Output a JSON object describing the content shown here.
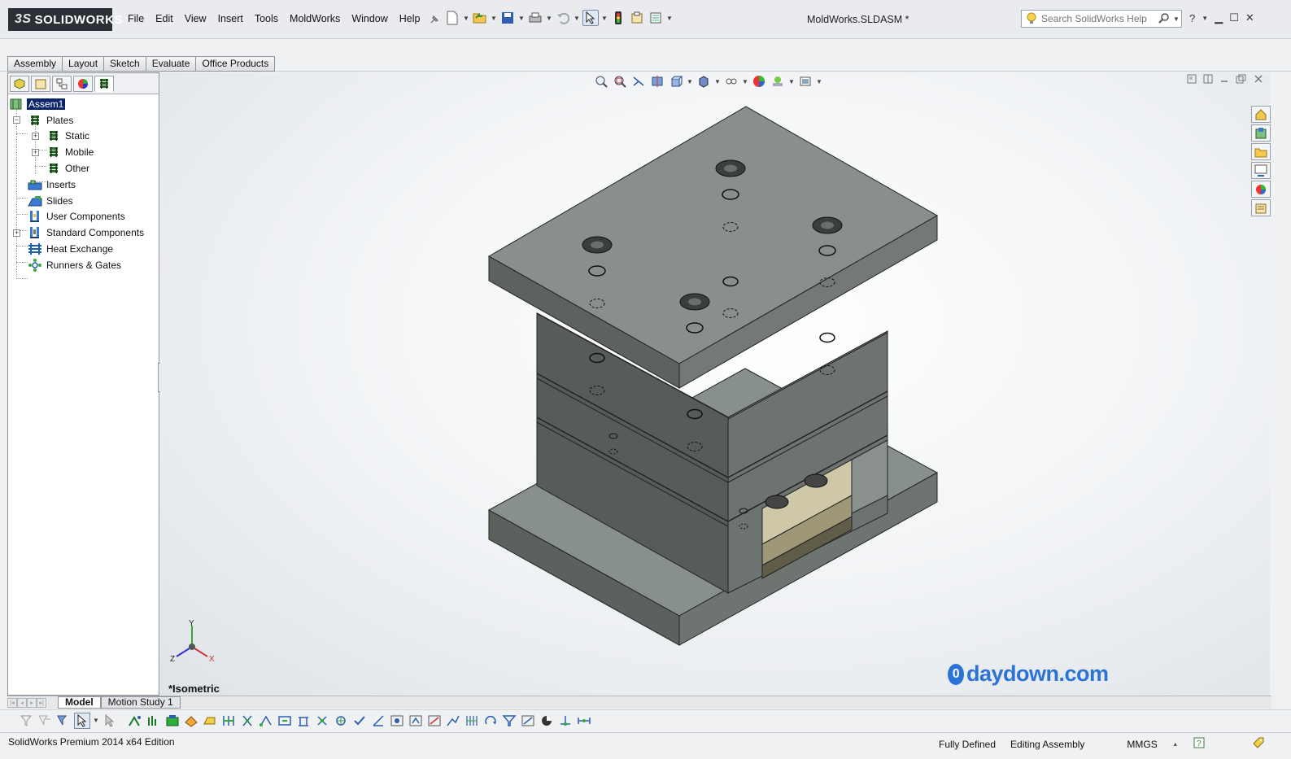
{
  "app": {
    "logo_text": "SOLIDWORKS",
    "document_title": "MoldWorks.SLDASM *"
  },
  "menu": [
    "File",
    "Edit",
    "View",
    "Insert",
    "Tools",
    "MoldWorks",
    "Window",
    "Help"
  ],
  "search": {
    "placeholder": "Search SolidWorks Help"
  },
  "command_tabs": [
    "Assembly",
    "Layout",
    "Sketch",
    "Evaluate",
    "Office Products"
  ],
  "feature_tree": {
    "root": "Assem1",
    "items": [
      {
        "label": "Plates",
        "icon": "plates-icon"
      },
      {
        "label": "Static",
        "icon": "plate-icon"
      },
      {
        "label": "Mobile",
        "icon": "plate-icon"
      },
      {
        "label": "Other",
        "icon": "plate-icon"
      },
      {
        "label": "Inserts",
        "icon": "inserts-icon"
      },
      {
        "label": "Slides",
        "icon": "slides-icon"
      },
      {
        "label": "User Components",
        "icon": "user-components-icon"
      },
      {
        "label": "Standard Components",
        "icon": "standard-components-icon"
      },
      {
        "label": "Heat Exchange",
        "icon": "heat-exchange-icon"
      },
      {
        "label": "Runners & Gates",
        "icon": "runners-gates-icon"
      }
    ]
  },
  "viewport": {
    "view_name": "*Isometric",
    "watermark": "daydown.com",
    "triad_axes": [
      "Y",
      "Z",
      "X"
    ]
  },
  "bottom_tabs": [
    "Model",
    "Motion Study 1"
  ],
  "status": {
    "edition": "SolidWorks Premium 2014 x64 Edition",
    "defined": "Fully Defined",
    "mode": "Editing Assembly",
    "units": "MMGS"
  }
}
